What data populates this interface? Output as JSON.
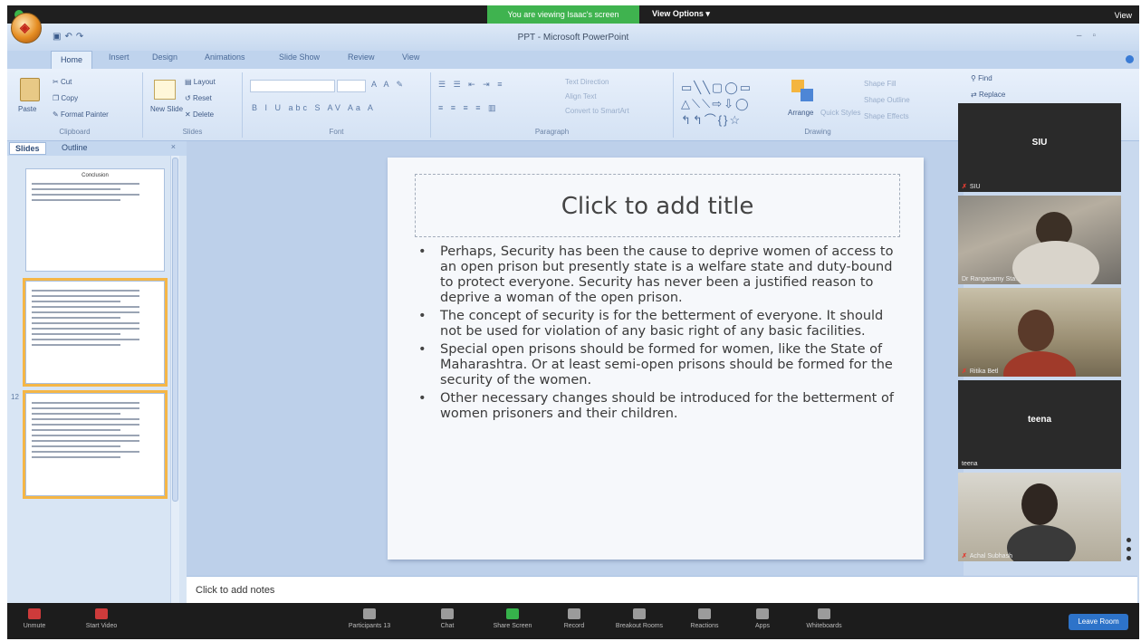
{
  "zoom": {
    "share_banner": "You are viewing Isaac's screen",
    "view_options": "View Options",
    "view_button": "View",
    "leave_button": "Leave Room",
    "toolbar": [
      {
        "label": "Unmute",
        "icon": "microphone-icon"
      },
      {
        "label": "Start Video",
        "icon": "video-icon"
      },
      {
        "label": "Participants",
        "icon": "participants-icon",
        "badge": "13"
      },
      {
        "label": "Chat",
        "icon": "chat-icon"
      },
      {
        "label": "Share Screen",
        "icon": "share-screen-icon"
      },
      {
        "label": "Record",
        "icon": "record-icon"
      },
      {
        "label": "Breakout Rooms",
        "icon": "breakout-rooms-icon"
      },
      {
        "label": "Reactions",
        "icon": "reactions-icon"
      },
      {
        "label": "Apps",
        "icon": "apps-icon"
      },
      {
        "label": "Whiteboards",
        "icon": "whiteboard-icon"
      }
    ],
    "participants": [
      {
        "display": "SIU",
        "label": "SIU",
        "video": false
      },
      {
        "display": "",
        "label": "Dr Rangasamy Sta...",
        "video": true
      },
      {
        "display": "",
        "label": "Ritika Betl",
        "video": true
      },
      {
        "display": "teena",
        "label": "teena",
        "video": false
      },
      {
        "display": "",
        "label": "Achal Subhash",
        "video": true
      }
    ]
  },
  "app": {
    "title": "PPT - Microsoft PowerPoint",
    "tabs": [
      "Home",
      "Insert",
      "Design",
      "Animations",
      "Slide Show",
      "Review",
      "View"
    ],
    "clipboard": {
      "paste": "Paste",
      "cut": "Cut",
      "copy": "Copy",
      "format_painter": "Format Painter",
      "label": "Clipboard"
    },
    "slides_group": {
      "new_slide": "New Slide",
      "layout": "Layout",
      "reset": "Reset",
      "delete": "Delete",
      "label": "Slides"
    },
    "font_group": {
      "label": "Font"
    },
    "paragraph_group": {
      "label": "Paragraph",
      "text_direction": "Text Direction",
      "align_text": "Align Text",
      "smartart": "Convert to SmartArt"
    },
    "drawing_group": {
      "label": "Drawing",
      "arrange": "Arrange",
      "quick_styles": "Quick Styles",
      "shape_fill": "Shape Fill",
      "shape_outline": "Shape Outline",
      "shape_effects": "Shape Effects"
    },
    "editing_group": {
      "find": "Find",
      "replace": "Replace"
    }
  },
  "pane": {
    "tabs": [
      "Slides",
      "Outline"
    ],
    "thumbs": [
      {
        "num": "",
        "title": "Conclusion"
      },
      {
        "num": "",
        "title": ""
      },
      {
        "num": "12",
        "title": ""
      }
    ]
  },
  "slide": {
    "title": "Click to add title",
    "bullets": [
      "Perhaps, Security has been the cause to deprive women of access to an open prison but presently state is a welfare state and duty-bound to protect everyone. Security has never been a justified reason to deprive a woman of the open prison.",
      "The concept of security is for the betterment of everyone. It should not be used for violation of any basic right of any basic facilities.",
      "Special open prisons should be formed for women, like the State of Maharashtra. Or at least semi-open prisons should be formed for the security of the women.",
      "Other necessary changes should be introduced for the betterment of women prisoners and their children."
    ]
  },
  "notes": {
    "placeholder": "Click to add notes"
  },
  "colors": {
    "ribbon": "#d4e2f4",
    "zoom_dark": "#1c1c1c",
    "share_green": "#3fb34f",
    "leave_blue": "#2d73c9",
    "thumb_selected": "#f5b646"
  }
}
